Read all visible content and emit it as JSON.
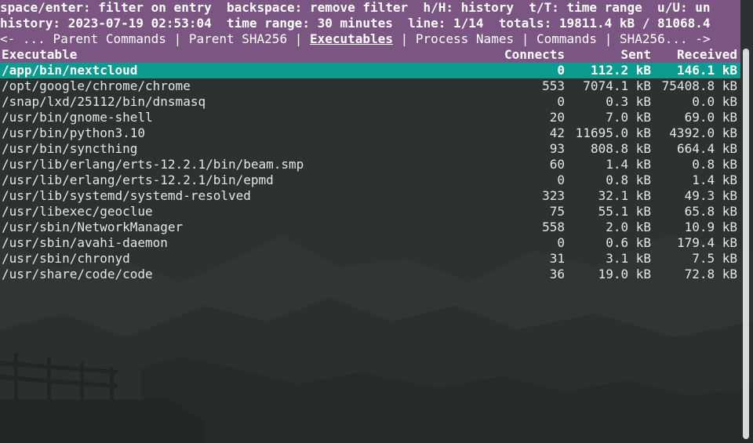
{
  "help_line": "space/enter: filter on entry  backspace: remove filter  h/H: history  t/T: time range  u/U: un",
  "status_line": "history: 2023-07-19 02:53:04  time range: 30 minutes  line: 1/14  totals: 19811.4 kB / 81068.4",
  "tabs": {
    "prefix": "<- ... ",
    "parent_commands": "Parent Commands",
    "parent_sha256": "Parent SHA256",
    "executables": "Executables",
    "process_names": "Process Names",
    "commands": "Commands",
    "sha256": "SHA256...",
    "suffix": " ->",
    "separator": " | "
  },
  "columns": {
    "executable": "Executable",
    "connects": "Connects",
    "sent": "Sent",
    "received": "Received"
  },
  "rows": [
    {
      "executable": "/app/bin/nextcloud",
      "connects": "0",
      "sent": "112.2 kB",
      "received": "146.1 kB",
      "selected": true
    },
    {
      "executable": "/opt/google/chrome/chrome",
      "connects": "553",
      "sent": "7074.1 kB",
      "received": "75408.8 kB"
    },
    {
      "executable": "/snap/lxd/25112/bin/dnsmasq",
      "connects": "0",
      "sent": "0.3 kB",
      "received": "0.0 kB"
    },
    {
      "executable": "/usr/bin/gnome-shell",
      "connects": "20",
      "sent": "7.0 kB",
      "received": "69.0 kB"
    },
    {
      "executable": "/usr/bin/python3.10",
      "connects": "42",
      "sent": "11695.0 kB",
      "received": "4392.0 kB"
    },
    {
      "executable": "/usr/bin/syncthing",
      "connects": "93",
      "sent": "808.8 kB",
      "received": "664.4 kB"
    },
    {
      "executable": "/usr/lib/erlang/erts-12.2.1/bin/beam.smp",
      "connects": "60",
      "sent": "1.4 kB",
      "received": "0.8 kB"
    },
    {
      "executable": "/usr/lib/erlang/erts-12.2.1/bin/epmd",
      "connects": "0",
      "sent": "0.8 kB",
      "received": "1.4 kB"
    },
    {
      "executable": "/usr/lib/systemd/systemd-resolved",
      "connects": "323",
      "sent": "32.1 kB",
      "received": "49.3 kB"
    },
    {
      "executable": "/usr/libexec/geoclue",
      "connects": "75",
      "sent": "55.1 kB",
      "received": "65.8 kB"
    },
    {
      "executable": "/usr/sbin/NetworkManager",
      "connects": "558",
      "sent": "2.0 kB",
      "received": "10.9 kB"
    },
    {
      "executable": "/usr/sbin/avahi-daemon",
      "connects": "0",
      "sent": "0.6 kB",
      "received": "179.4 kB"
    },
    {
      "executable": "/usr/sbin/chronyd",
      "connects": "31",
      "sent": "3.1 kB",
      "received": "7.5 kB"
    },
    {
      "executable": "/usr/share/code/code",
      "connects": "36",
      "sent": "19.0 kB",
      "received": "72.8 kB"
    }
  ],
  "colors": {
    "background": "#2c3131",
    "header": "#7c5683",
    "selected_row": "#0d9a91",
    "text": "#e6e6e6"
  }
}
